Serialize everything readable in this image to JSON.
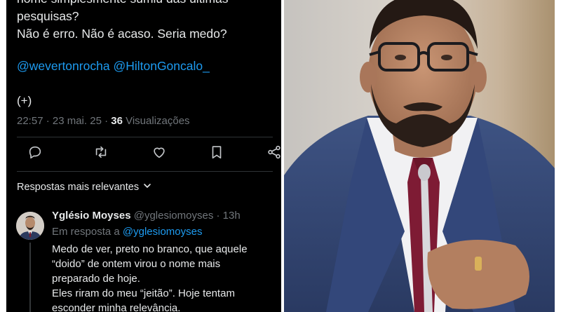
{
  "tweet": {
    "lines": [
      "nome simplesmente sumiu das últimas",
      "pesquisas?",
      "Não é erro. Não é acaso. Seria medo?"
    ],
    "mention_1": "@wevertonrocha",
    "mention_2": "@HiltonGoncalo_",
    "expand_label": "(+)",
    "time": "22:57 · 23 mai. 25 · ",
    "views_count": "36",
    "views_label": " Visualizações"
  },
  "actions": {
    "icons": [
      "reply-icon",
      "retweet-icon",
      "like-icon",
      "bookmark-icon",
      "share-icon"
    ]
  },
  "replies_section": {
    "sort_label": "Respostas mais relevantes"
  },
  "reply": {
    "name": "Yglésio Moyses",
    "handle": " @yglesiomoyses · 13h",
    "in_reply_prefix": "Em resposta a ",
    "in_reply_handle": "@yglesiomoyses",
    "lines": [
      "Medo de ver, preto no branco, que aquele",
      "“doido” de ontem virou o nome mais",
      "preparado de hoje.",
      "Eles riram do meu “jeitão”. Hoje tentam",
      "esconder minha relevância."
    ]
  },
  "colors": {
    "background": "#000000",
    "text": "#e7e9ea",
    "muted": "#71767b",
    "link": "#1d9bf0"
  }
}
